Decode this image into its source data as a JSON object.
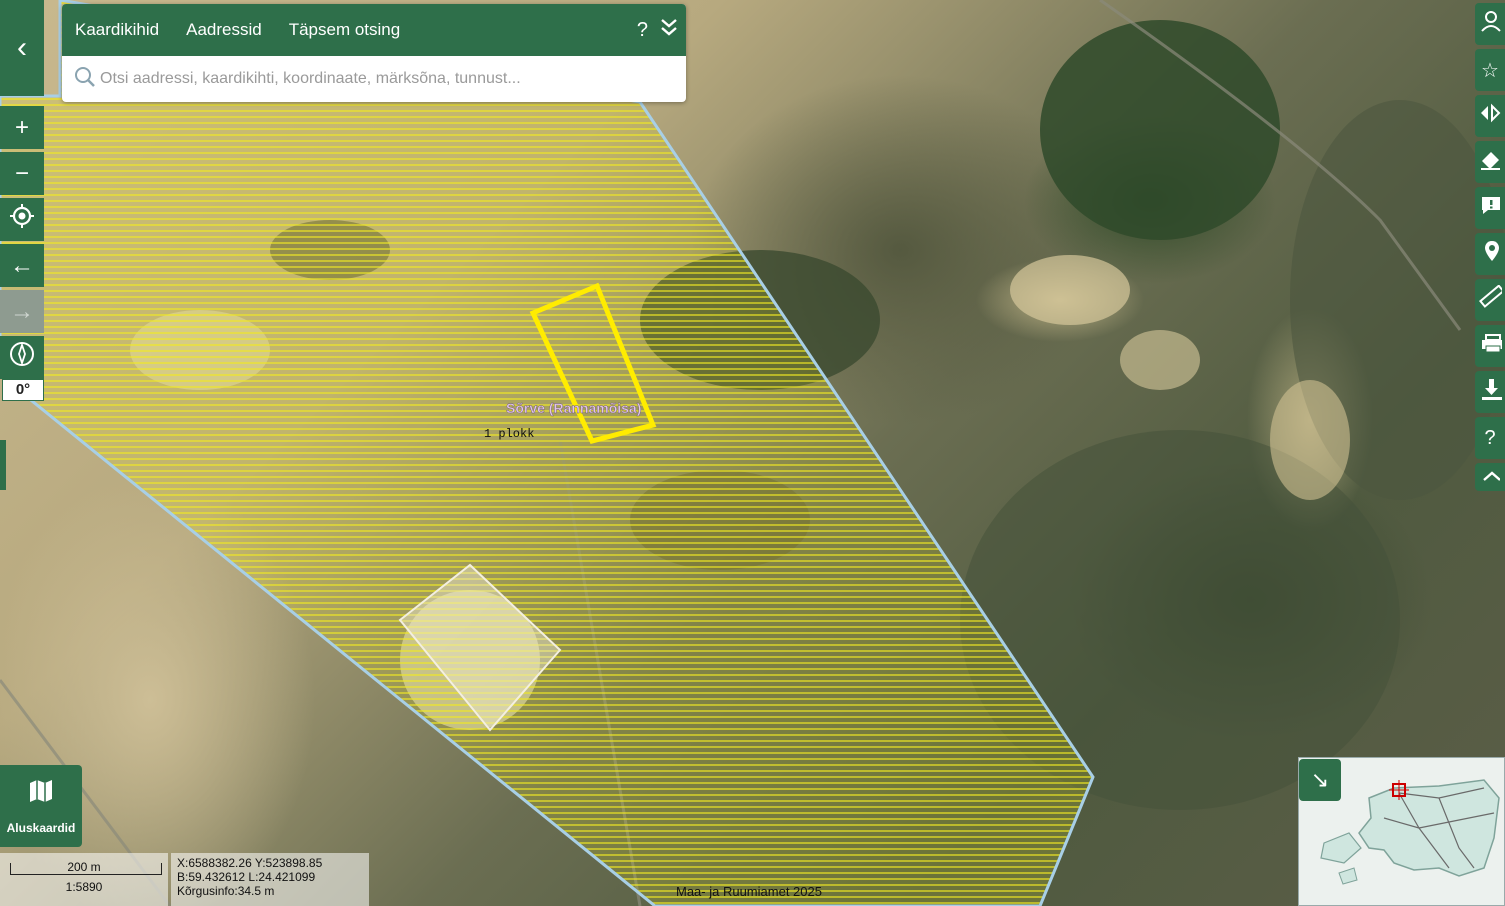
{
  "search": {
    "tabs": [
      "Kaardikihid",
      "Aadressid",
      "Täpsem otsing"
    ],
    "help_label": "?",
    "collapse_label": "⌄",
    "placeholder": "Otsi aadressi, kaardikihti, koordinaate, märksõna, tunnust..."
  },
  "left_toolbar": {
    "back": "‹",
    "zoom_in": "+",
    "zoom_out": "−",
    "locate": "◎",
    "prev_view": "←",
    "next_view": "→",
    "compass": "⊘",
    "rotation": "0°"
  },
  "right_toolbar": {
    "icons": [
      "user-icon",
      "star-icon",
      "compare-icon",
      "eraser-icon",
      "feedback-icon",
      "pin-icon",
      "ruler-icon",
      "print-icon",
      "download-icon",
      "help-icon",
      "chevron-up-icon"
    ],
    "help_label": "?"
  },
  "map": {
    "place_label": "Sõrve (Rannamõisa)",
    "block_label": "1 plokk",
    "copyright": "Maa- ja Ruumiamet 2025",
    "colors": {
      "hatch": "#e9e21e",
      "polygon_outline": "#a8cfe6",
      "selection": "#ffec00",
      "place_label": "#e3c4ec"
    }
  },
  "basemaps": {
    "label": "Aluskaardid"
  },
  "scale": {
    "distance": "200 m",
    "ratio": "1:5890"
  },
  "coords": {
    "xy": "X:6588382.26 Y:523898.85",
    "bl": "B:59.432612 L:24.421099",
    "height": "Kõrgusinfo:34.5 m"
  },
  "overview": {
    "button": "↘"
  }
}
